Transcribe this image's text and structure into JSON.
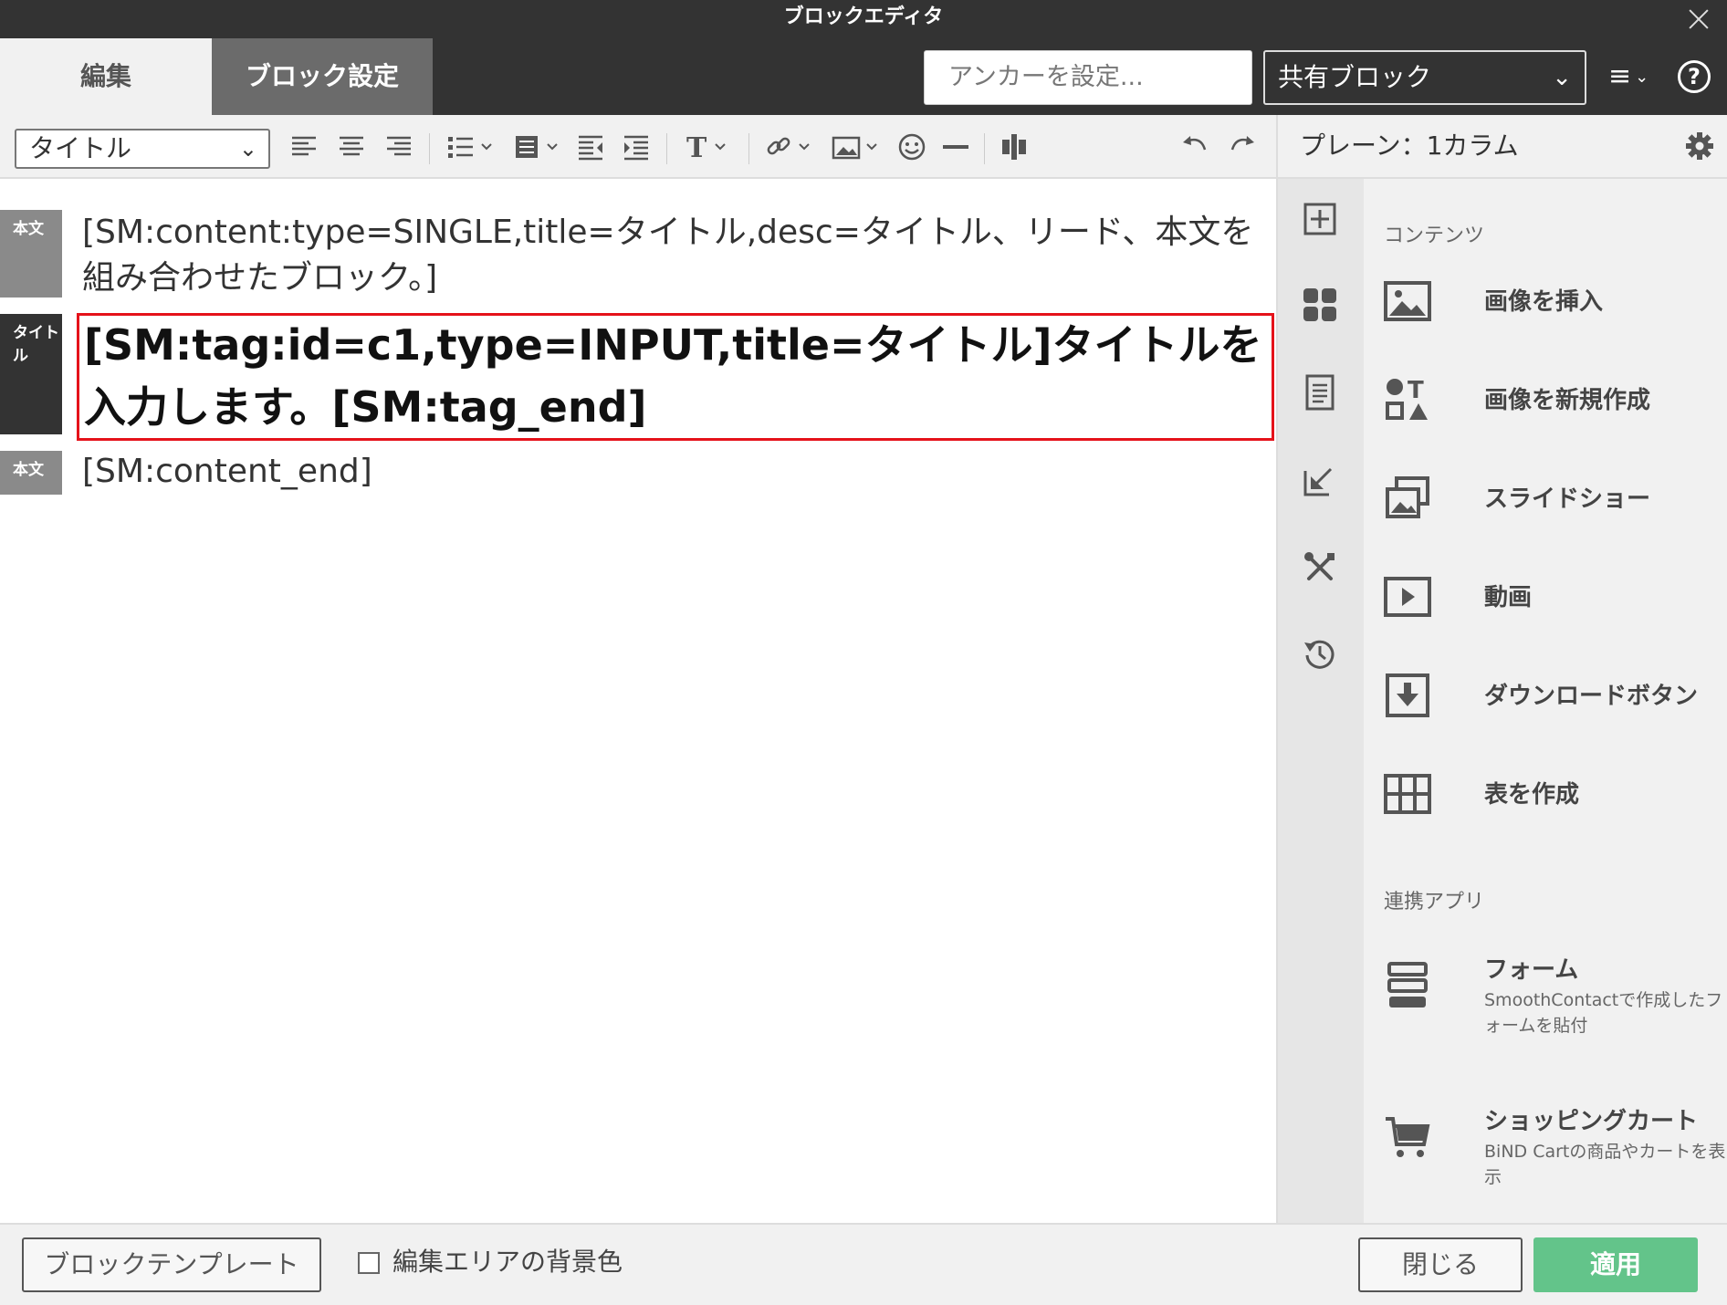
{
  "window": {
    "title": "ブロックエディタ"
  },
  "tabs": {
    "edit": "編集",
    "block_settings": "ブロック設定"
  },
  "header": {
    "anchor_placeholder": "アンカーを設定...",
    "shared_block": "共有ブロック"
  },
  "toolbar": {
    "style_select": "タイトル"
  },
  "panel": {
    "title": "プレーン：1カラム",
    "sections": {
      "contents": "コンテンツ",
      "apps": "連携アプリ"
    },
    "contents": [
      {
        "label": "画像を挿入",
        "icon": "insert-image-icon"
      },
      {
        "label": "画像を新規作成",
        "icon": "new-image-icon"
      },
      {
        "label": "スライドショー",
        "icon": "slideshow-icon"
      },
      {
        "label": "動画",
        "icon": "video-icon"
      },
      {
        "label": "ダウンロードボタン",
        "icon": "download-button-icon"
      },
      {
        "label": "表を作成",
        "icon": "table-icon"
      }
    ],
    "apps": [
      {
        "label": "フォーム",
        "sub": "SmoothContactで作成したフォームを貼付",
        "icon": "form-icon"
      },
      {
        "label": "ショッピングカート",
        "sub": "BiND Cartの商品やカートを表示",
        "icon": "cart-icon"
      }
    ]
  },
  "editor": {
    "rows": [
      {
        "tag": "本文",
        "text": "[SM:content:type=SINGLE,title=タイトル,desc=タイトル、リード、本文を組み合わせたブロック。]"
      },
      {
        "tag": "タイトル",
        "text": "[SM:tag:id=c1,type=INPUT,title=タイトル]タイトルを入力します。[SM:tag_end]"
      },
      {
        "tag": "本文",
        "text": "[SM:content_end]"
      }
    ]
  },
  "footer": {
    "template_button": "ブロックテンプレート",
    "bg_color_label": "編集エリアの背景色",
    "close_button": "閉じる",
    "apply_button": "適用"
  },
  "colors": {
    "dark": "#333333",
    "highlight": "#e5121a",
    "apply": "#63c48a",
    "tag_body": "#8a8a8a",
    "tag_title": "#333333"
  }
}
